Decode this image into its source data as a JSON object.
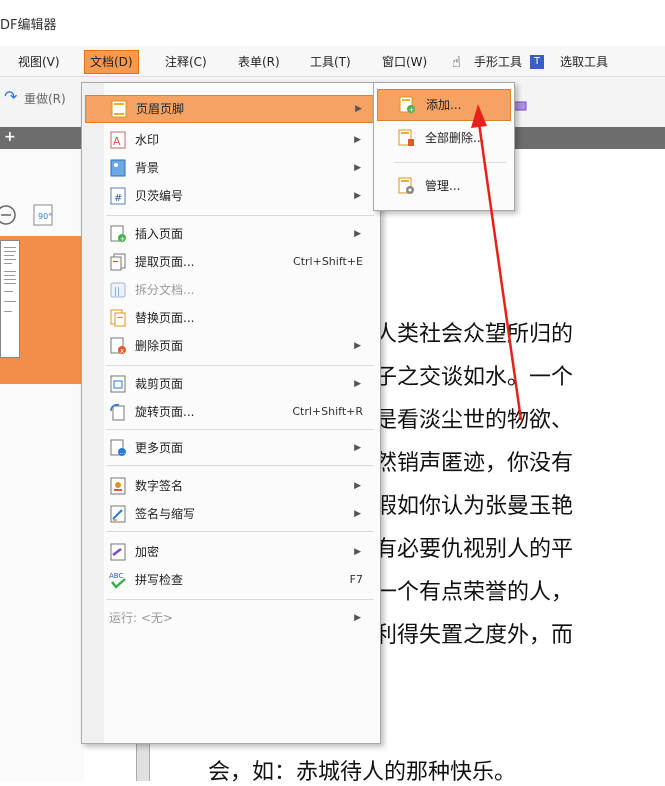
{
  "app_title": "DF编辑器",
  "menubar": [
    {
      "label": "视图(V)"
    },
    {
      "label": "文档(D)"
    },
    {
      "label": "注释(C)"
    },
    {
      "label": "表单(R)"
    },
    {
      "label": "工具(T)"
    },
    {
      "label": "窗口(W)"
    },
    {
      "label": "手形工具"
    },
    {
      "label": "选取工具"
    }
  ],
  "toolbar": {
    "redo_label": "重做(R)"
  },
  "menu": [
    {
      "label": "页眉页脚",
      "icon": "page-header-footer-icon",
      "shortcut": "",
      "submenu": true,
      "hl": true
    },
    {
      "label": "水印",
      "icon": "watermark-icon",
      "shortcut": "",
      "submenu": true
    },
    {
      "label": "背景",
      "icon": "background-icon",
      "shortcut": "",
      "submenu": true
    },
    {
      "label": "贝茨编号",
      "icon": "bates-number-icon",
      "shortcut": "",
      "submenu": true
    },
    {
      "label": "插入页面",
      "icon": "insert-page-icon",
      "shortcut": "",
      "submenu": true
    },
    {
      "label": "提取页面...",
      "icon": "extract-page-icon",
      "shortcut": "Ctrl+Shift+E",
      "submenu": false
    },
    {
      "label": "拆分文档...",
      "icon": "split-document-icon",
      "shortcut": "",
      "submenu": false,
      "dim": true
    },
    {
      "label": "替换页面...",
      "icon": "replace-page-icon",
      "shortcut": "",
      "submenu": false
    },
    {
      "label": "删除页面",
      "icon": "delete-page-icon",
      "shortcut": "",
      "submenu": true
    },
    {
      "label": "裁剪页面",
      "icon": "crop-page-icon",
      "shortcut": "",
      "submenu": true
    },
    {
      "label": "旋转页面...",
      "icon": "rotate-page-icon",
      "shortcut": "Ctrl+Shift+R",
      "submenu": false
    },
    {
      "label": "更多页面",
      "icon": "more-pages-icon",
      "shortcut": "",
      "submenu": true
    },
    {
      "label": "数字签名",
      "icon": "digital-signature-icon",
      "shortcut": "",
      "submenu": true
    },
    {
      "label": "签名与缩写",
      "icon": "sign-initials-icon",
      "shortcut": "",
      "submenu": true
    },
    {
      "label": "加密",
      "icon": "encrypt-icon",
      "shortcut": "",
      "submenu": true
    },
    {
      "label": "拼写检查",
      "icon": "spell-check-icon",
      "shortcut": "F7",
      "submenu": false
    },
    {
      "label": "运行: <无>",
      "icon": "run-icon",
      "shortcut": "",
      "submenu": true,
      "dim": true
    }
  ],
  "submenu": [
    {
      "label": "添加...",
      "icon": "add-header-icon",
      "hl": true
    },
    {
      "label": "全部删除...",
      "icon": "delete-all-icon"
    },
    {
      "label": "管理...",
      "icon": "manage-icon"
    }
  ],
  "doc_lines": [
    "人类社会众望所归的",
    "子之交谈如水。一个",
    "是看淡尘世的物欲、",
    "然销声匿迹，你没有",
    "假如你认为张曼玉艳",
    "有必要仇视别人的平",
    "一个有点荣誉的人，",
    "利得失置之度外，而",
    "会，如：赤城待人的那种快乐。"
  ],
  "colors": {
    "accent": "#f5a262",
    "arrow": "#e8201a"
  }
}
